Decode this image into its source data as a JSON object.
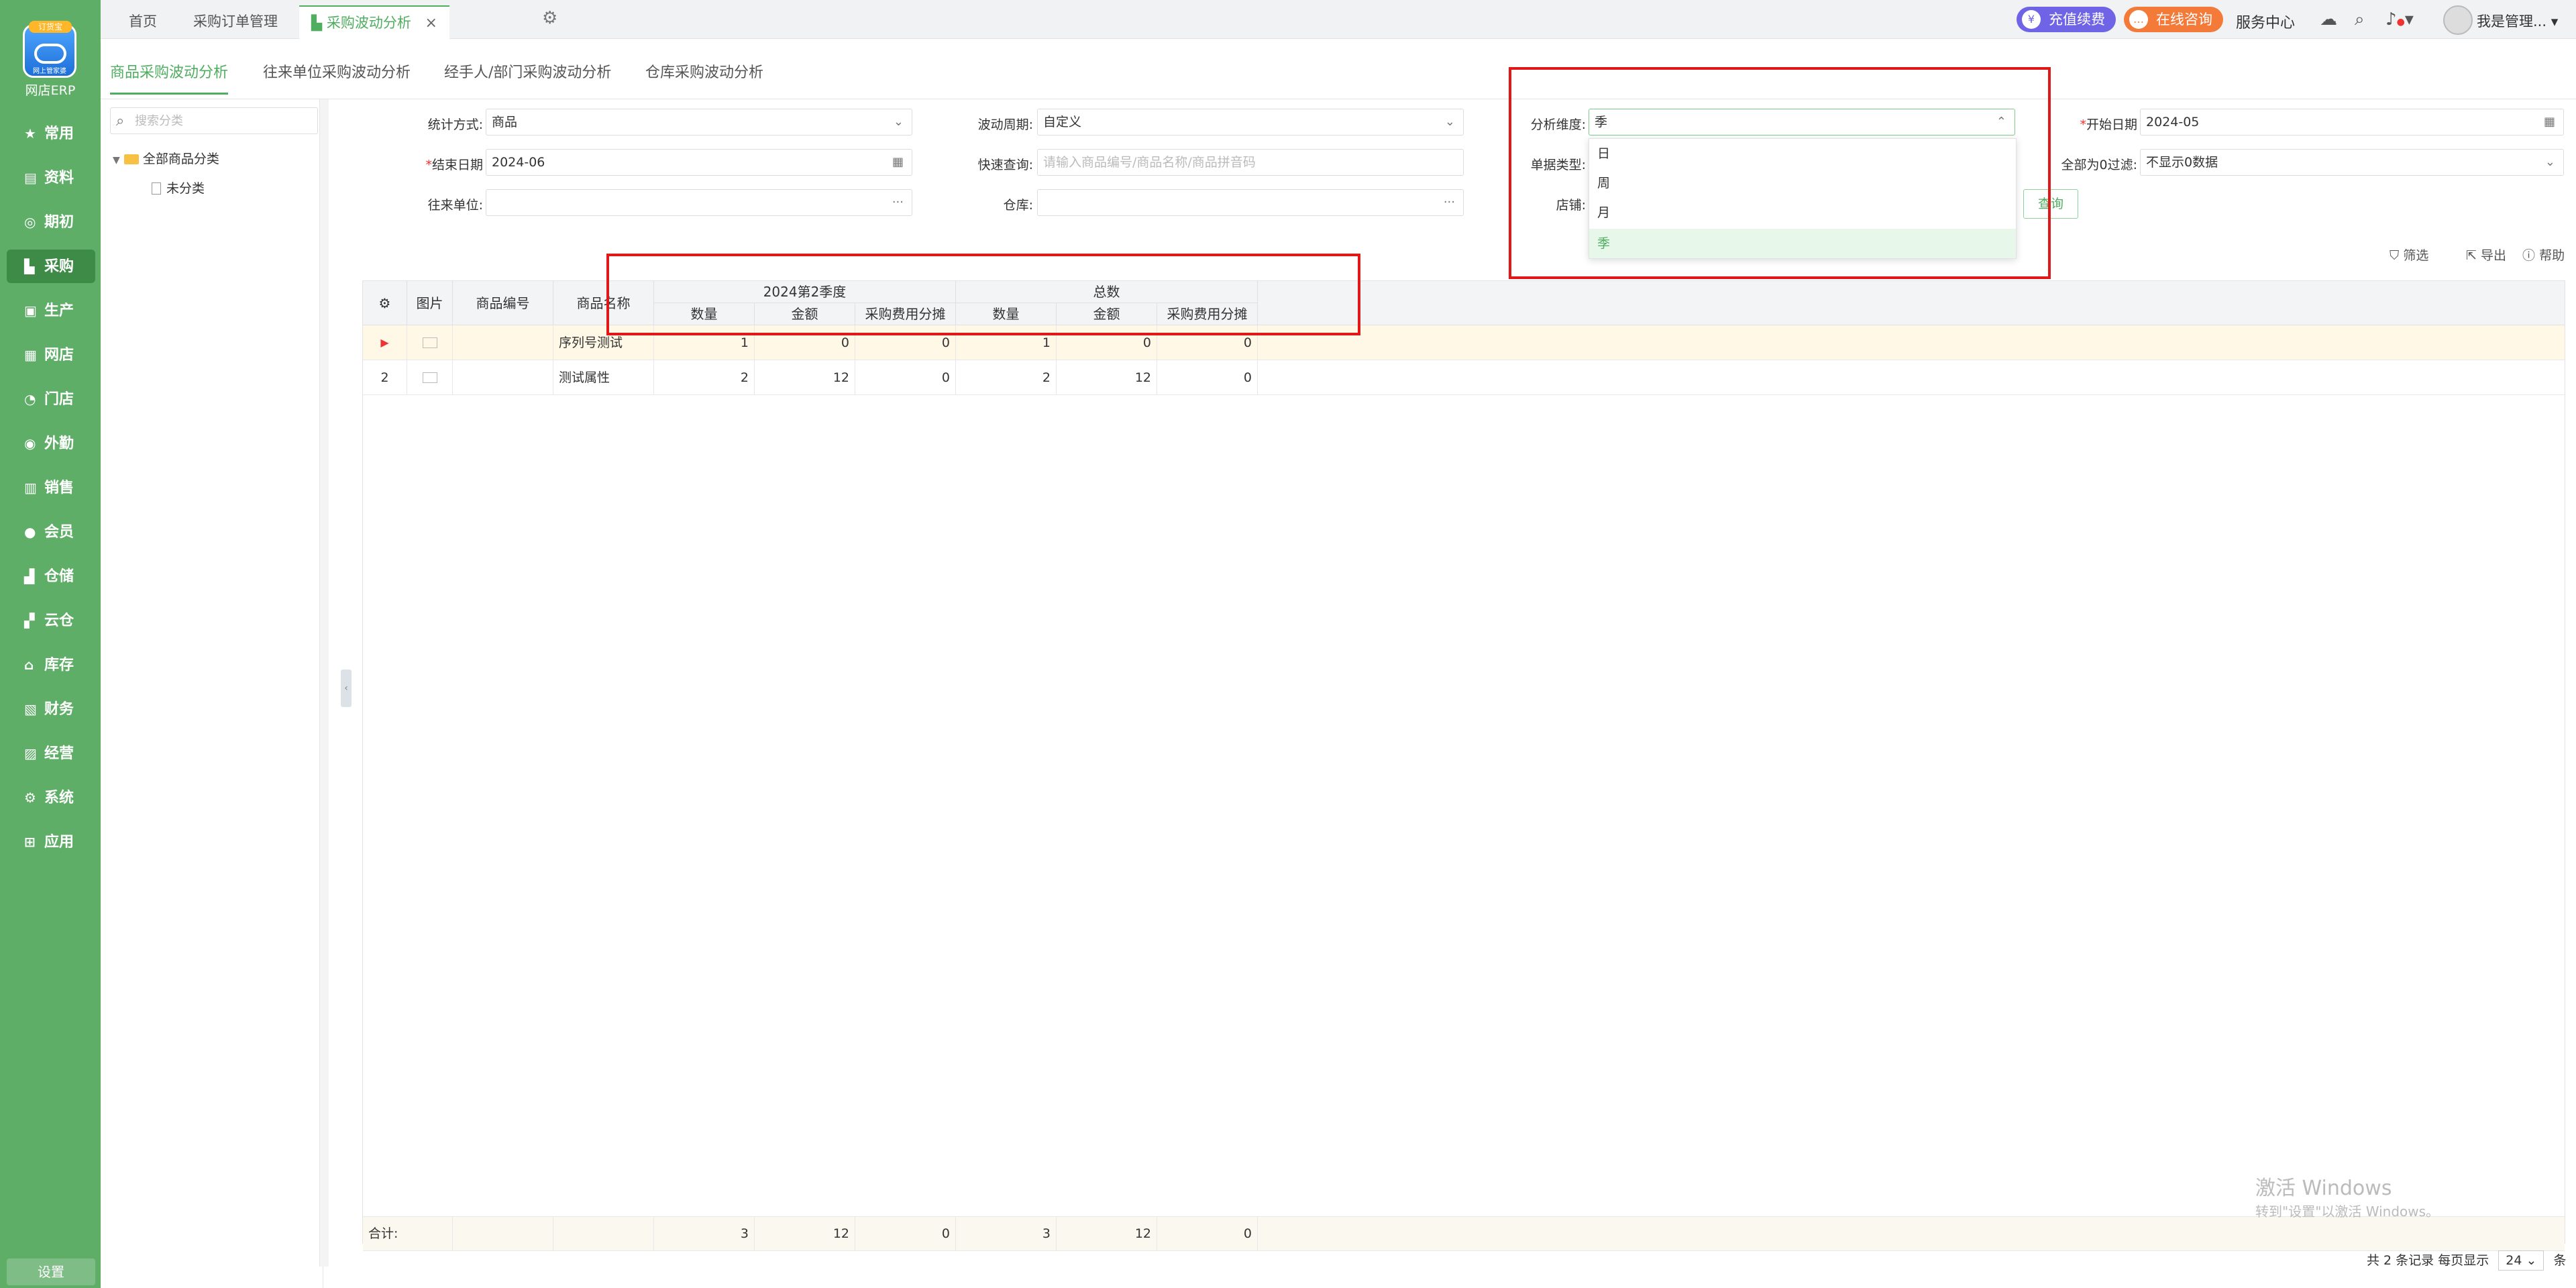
{
  "sidebar": {
    "app_name": "网店ERP",
    "logo_badge": "订货宝",
    "logo_text": "网上管家婆",
    "settings": "设置",
    "items": [
      {
        "label": "常用",
        "icon": "★"
      },
      {
        "label": "资料",
        "icon": "▤"
      },
      {
        "label": "期初",
        "icon": "◎"
      },
      {
        "label": "采购",
        "icon": "▙"
      },
      {
        "label": "生产",
        "icon": "▣"
      },
      {
        "label": "网店",
        "icon": "▦"
      },
      {
        "label": "门店",
        "icon": "◔"
      },
      {
        "label": "外勤",
        "icon": "◉"
      },
      {
        "label": "销售",
        "icon": "▥"
      },
      {
        "label": "会员",
        "icon": "●"
      },
      {
        "label": "仓储",
        "icon": "▟"
      },
      {
        "label": "云仓",
        "icon": "▞"
      },
      {
        "label": "库存",
        "icon": "⌂"
      },
      {
        "label": "财务",
        "icon": "▧"
      },
      {
        "label": "经营",
        "icon": "▨"
      },
      {
        "label": "系统",
        "icon": "⚙"
      },
      {
        "label": "应用",
        "icon": "⊞"
      }
    ]
  },
  "tabs": {
    "home": "首页",
    "order": "采购订单管理",
    "analysis": "采购波动分析",
    "close": "×",
    "gear": "⚙"
  },
  "header": {
    "recharge": "充值续费",
    "consult": "在线咨询",
    "service": "服务中心",
    "user": "我是管理...",
    "icons": [
      "cloud-icon",
      "search-icon",
      "bell-icon"
    ]
  },
  "subtabs": [
    "商品采购波动分析",
    "往来单位采购波动分析",
    "经手人/部门采购波动分析",
    "仓库采购波动分析"
  ],
  "tree": {
    "search_placeholder": "搜索分类",
    "root": "全部商品分类",
    "child": "未分类"
  },
  "form": {
    "stat_mode_label": "统计方式:",
    "stat_mode_value": "商品",
    "period_label": "波动周期:",
    "period_value": "自定义",
    "dimension_label": "分析维度:",
    "dimension_value": "季",
    "start_label": "开始日期",
    "start_value": "2024-05",
    "end_label": "结束日期",
    "end_value": "2024-06",
    "quick_label": "快速查询:",
    "quick_placeholder": "请输入商品编号/商品名称/商品拼音码",
    "doctype_label": "单据类型:",
    "filter0_label": "全部为0过滤:",
    "filter0_value": "不显示0数据",
    "partner_label": "往来单位:",
    "warehouse_label": "仓库:",
    "shop_label": "店铺:",
    "query_btn": "查询",
    "ellipsis": "···"
  },
  "dropdown": {
    "options": [
      "日",
      "周",
      "月",
      "季"
    ],
    "selected": "季"
  },
  "toolbar": {
    "filter": "筛选",
    "export": "导出",
    "help": "帮助"
  },
  "table": {
    "headers": {
      "image": "图片",
      "code": "商品编号",
      "name": "商品名称",
      "group1": "2024第2季度",
      "group2": "总数",
      "qty": "数量",
      "amount": "金额",
      "fee": "采购费用分摊"
    },
    "rows": [
      {
        "no": "▶",
        "name": "序列号测试",
        "q1": "1",
        "a1": "0",
        "f1": "0",
        "q2": "1",
        "a2": "0",
        "f2": "0"
      },
      {
        "no": "2",
        "name": "测试属性",
        "q1": "2",
        "a1": "12",
        "f1": "0",
        "q2": "2",
        "a2": "12",
        "f2": "0"
      }
    ],
    "total": {
      "label": "合计:",
      "q1": "3",
      "a1": "12",
      "f1": "0",
      "q2": "3",
      "a2": "12",
      "f2": "0"
    }
  },
  "watermark": {
    "line1": "激活 Windows",
    "line2": "转到\"设置\"以激活 Windows。"
  },
  "pager": {
    "summary": "共 2 条记录  每页显示",
    "page_size": "24",
    "unit": "条"
  }
}
